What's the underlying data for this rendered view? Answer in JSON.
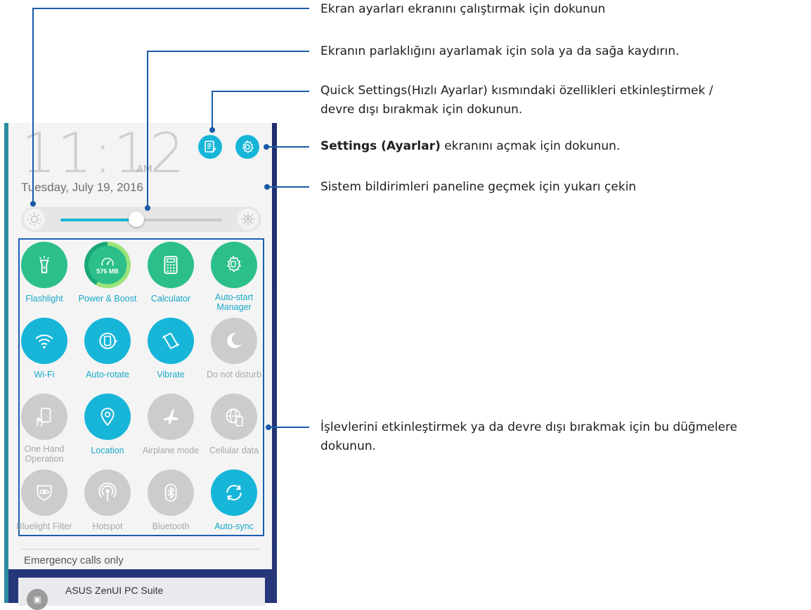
{
  "phone": {
    "time": "11:12",
    "ampm": "AM",
    "date": "Tuesday, July 19, 2016",
    "brightness_level": 0.47,
    "tiles": [
      {
        "label": "Flashlight",
        "icon": "flashlight-icon",
        "state": "on"
      },
      {
        "label": "Power & Boost",
        "icon": "speedometer-icon",
        "state": "on",
        "badge": "576 MB"
      },
      {
        "label": "Calculator",
        "icon": "calculator-icon",
        "state": "on"
      },
      {
        "label": "Auto-start Manager",
        "icon": "gear-shield-icon",
        "state": "on"
      },
      {
        "label": "Wi-Fi",
        "icon": "wifi-icon",
        "state": "on"
      },
      {
        "label": "Auto-rotate",
        "icon": "rotate-icon",
        "state": "on"
      },
      {
        "label": "Vibrate",
        "icon": "vibrate-icon",
        "state": "on"
      },
      {
        "label": "Do not disturb",
        "icon": "moon-icon",
        "state": "off"
      },
      {
        "label": "One Hand Operation",
        "icon": "one-hand-icon",
        "state": "off"
      },
      {
        "label": "Location",
        "icon": "location-pin-icon",
        "state": "on"
      },
      {
        "label": "Airplane mode",
        "icon": "airplane-icon",
        "state": "off"
      },
      {
        "label": "Cellular data",
        "icon": "globe-icon",
        "state": "off"
      },
      {
        "label": "Bluelight Filter",
        "icon": "eye-shield-icon",
        "state": "off"
      },
      {
        "label": "Hotspot",
        "icon": "hotspot-icon",
        "state": "off"
      },
      {
        "label": "Bluetooth",
        "icon": "bluetooth-icon",
        "state": "off"
      },
      {
        "label": "Auto-sync",
        "icon": "sync-icon",
        "state": "on"
      }
    ],
    "status": "Emergency calls only",
    "notification_title": "ASUS ZenUI PC Suite"
  },
  "callouts": {
    "display_settings": "Ekran ayarları ekranını çalıştırmak için dokunun",
    "brightness": "Ekranın parlaklığını ayarlamak için sola ya da sağa kaydırın.",
    "quick_settings_1": "Quick Settings(Hızlı Ayarlar) kısmındaki özellikleri etkinleştirmek /",
    "quick_settings_2": "devre dışı bırakmak için dokunun.",
    "settings_bold": "Settings (Ayarlar)",
    "settings_rest": " ekranını açmak için dokunun.",
    "system_panel": "Sistem bildirimleri paneline geçmek için yukarı çekin",
    "toggle_1": "İşlevlerini etkinleştirmek ya da devre dışı bırakmak için bu düğmelere",
    "toggle_2": "dokunun."
  },
  "colors": {
    "accent": "#17b6d9",
    "green": "#2cbf8a",
    "callout_line": "#1a5aa8"
  }
}
